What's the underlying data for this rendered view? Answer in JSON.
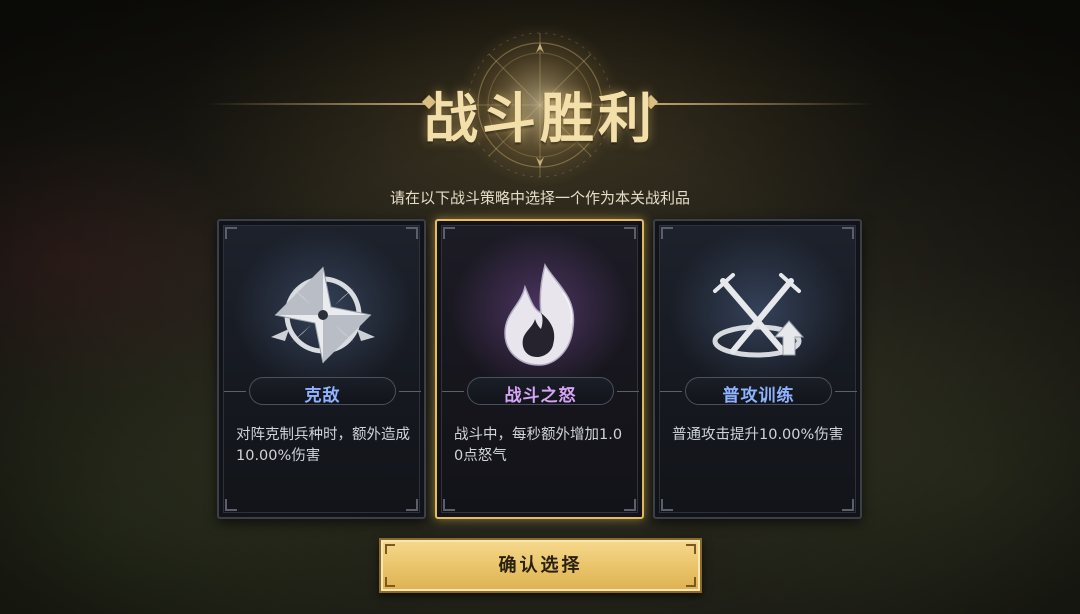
{
  "header": {
    "title": "战斗胜利",
    "subtitle": "请在以下战斗策略中选择一个作为本关战利品"
  },
  "cards": [
    {
      "name": "克敌",
      "description": "对阵克制兵种时，额外造成10.00%伤害",
      "icon": "compass-star-icon",
      "name_color": "#8fb3ff",
      "selected": false
    },
    {
      "name": "战斗之怒",
      "description": "战斗中，每秒额外增加1.00点怒气",
      "icon": "flame-icon",
      "name_color": "#d7a4f5",
      "selected": true
    },
    {
      "name": "普攻训练",
      "description": "普通攻击提升10.00%伤害",
      "icon": "crossed-swords-up-arrow-icon",
      "name_color": "#8fb3ff",
      "selected": false
    }
  ],
  "confirm": {
    "label": "确认选择"
  },
  "colors": {
    "title_gold": "#f3dfaa",
    "selected_border": "#e5bd5e",
    "button_gold": "#eac56b"
  }
}
